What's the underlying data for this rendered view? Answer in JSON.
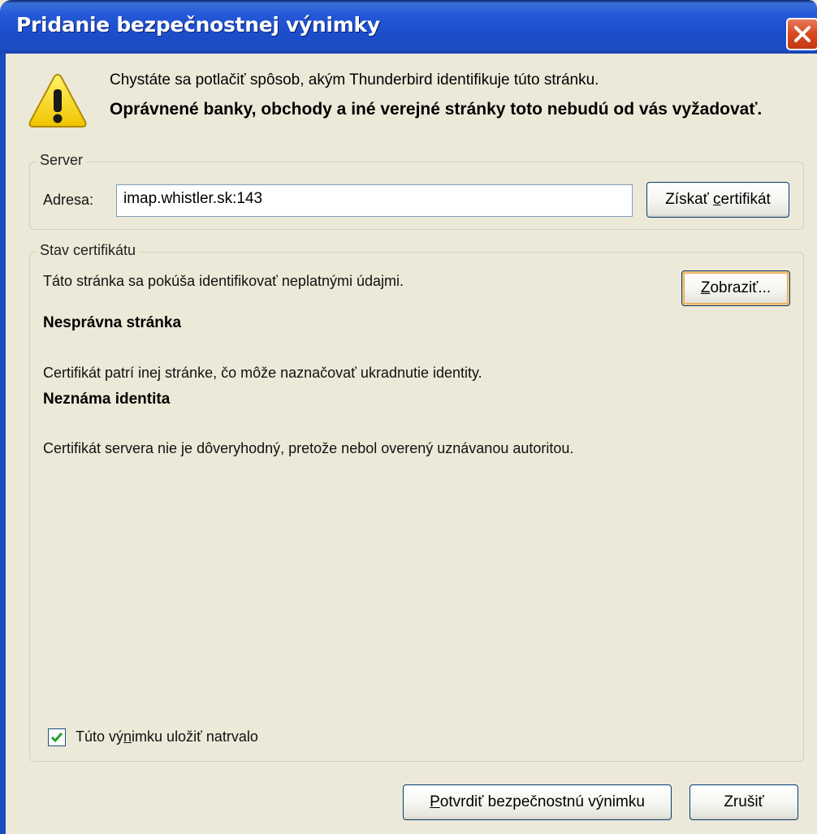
{
  "window": {
    "title": "Pridanie bezpečnostnej výnimky"
  },
  "icons": {
    "warning": "warning-icon",
    "close": "close-icon",
    "check": "checkmark-icon"
  },
  "message": {
    "line1": "Chystáte sa potlačiť spôsob, akým Thunderbird identifikuje túto stránku.",
    "line2": "Oprávnené banky, obchody a iné verejné stránky toto nebudú od vás vyžadovať."
  },
  "server": {
    "legend": "Server",
    "address_label": "Adresa:",
    "address_value": "imap.whistler.sk:143",
    "get_cert_pre": "Získať ",
    "get_cert_key": "c",
    "get_cert_post": "ertifikát"
  },
  "cert_status": {
    "legend": "Stav certifikátu",
    "summary": "Táto stránka sa pokúša identifikovať neplatnými údajmi.",
    "view_key": "Z",
    "view_post": "obraziť...",
    "problems": [
      {
        "title": "Nesprávna stránka",
        "detail": "Certifikát patrí inej stránke, čo môže naznačovať ukradnutie identity."
      },
      {
        "title": "Neznáma identita",
        "detail": "Certifikát servera nie je dôveryhodný, pretože nebol overený uznávanou autoritou."
      }
    ],
    "permanent_pre": "Túto vý",
    "permanent_key": "n",
    "permanent_post": "imku uložiť natrvalo",
    "permanent_checked": true
  },
  "buttons": {
    "confirm_key": "P",
    "confirm_post": "otvrdiť bezpečnostnú výnimku",
    "cancel": "Zrušiť"
  },
  "colors": {
    "titlebar": "#2458d8",
    "dialog_bg": "#ece9d8",
    "close": "#d7481e"
  }
}
